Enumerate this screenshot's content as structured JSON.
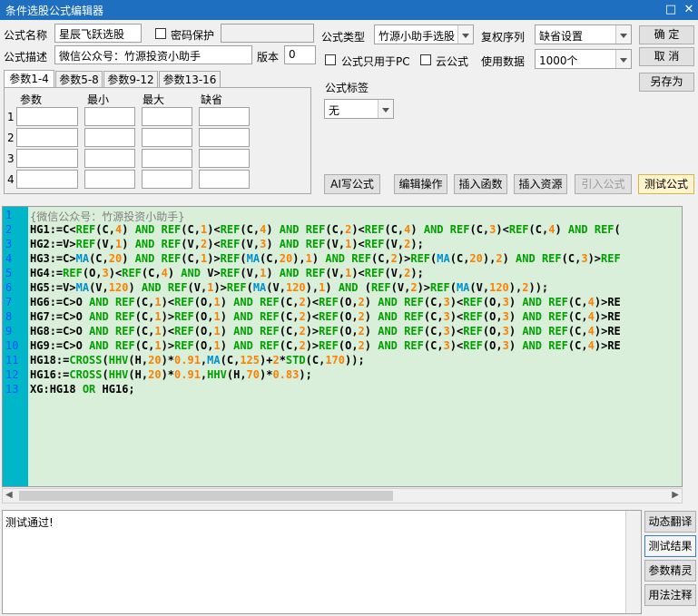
{
  "window": {
    "title": "条件选股公式编辑器",
    "close_glyph": "✕",
    "maximize_glyph": "□"
  },
  "form": {
    "name_label": "公式名称",
    "name_value": "星辰飞跃选股",
    "password_label": "密码保护",
    "desc_label": "公式描述",
    "desc_value": "微信公众号：竹源投资小助手",
    "version_label": "版本",
    "version_value": "0",
    "type_label": "公式类型",
    "type_value": "竹源小助手选股",
    "fuquan_label": "复权序列",
    "fuquan_value": "缺省设置",
    "pc_only_label": "公式只用于PC",
    "cloud_label": "云公式",
    "usedata_label": "使用数据",
    "usedata_value": "1000个",
    "tag_label": "公式标签",
    "tag_value": "无"
  },
  "buttons": {
    "ok": "确 定",
    "cancel": "取 消",
    "saveas": "另存为",
    "ai": "AI写公式",
    "edit_ops": "编辑操作",
    "insert_func": "插入函数",
    "insert_res": "插入资源",
    "import": "引入公式",
    "test": "测试公式"
  },
  "param_tabs": [
    "参数1-4",
    "参数5-8",
    "参数9-12",
    "参数13-16"
  ],
  "param_headers": [
    "参数",
    "最小",
    "最大",
    "缺省"
  ],
  "param_rows": [
    "1",
    "2",
    "3",
    "4"
  ],
  "code_lines": [
    "{微信公众号：竹源投资小助手}",
    "HG1:=C<REF(C,4) AND REF(C,1)<REF(C,4) AND REF(C,2)<REF(C,4) AND REF(C,3)<REF(C,4) AND REF(",
    "HG2:=V>REF(V,1) AND REF(V,2)<REF(V,3) AND REF(V,1)<REF(V,2);",
    "HG3:=C>MA(C,20) AND REF(C,1)>REF(MA(C,20),1) AND REF(C,2)>REF(MA(C,20),2) AND REF(C,3)>REF",
    "HG4:=REF(O,3)<REF(C,4) AND V>REF(V,1) AND REF(V,1)<REF(V,2);",
    "HG5:=V>MA(V,120) AND REF(V,1)>REF(MA(V,120),1) AND (REF(V,2)>REF(MA(V,120),2));",
    "HG6:=C>O AND REF(C,1)<REF(O,1) AND REF(C,2)<REF(O,2) AND REF(C,3)<REF(O,3) AND REF(C,4)>RE",
    "HG7:=C>O AND REF(C,1)>REF(O,1) AND REF(C,2)<REF(O,2) AND REF(C,3)<REF(O,3) AND REF(C,4)>RE",
    "HG8:=C>O AND REF(C,1)<REF(O,1) AND REF(C,2)>REF(O,2) AND REF(C,3)<REF(O,3) AND REF(C,4)>RE",
    "HG9:=C>O AND REF(C,1)>REF(O,1) AND REF(C,2)>REF(O,2) AND REF(C,3)<REF(O,3) AND REF(C,4)>RE",
    "HG18:=CROSS(HHV(H,20)*0.91,MA(C,125)+2*STD(C,170));",
    "HG16:=CROSS(HHV(H,20)*0.91,HHV(H,70)*0.83);",
    "XG:HG18 OR HG16;"
  ],
  "output_text": "测试通过!",
  "side_buttons": [
    "动态翻译",
    "测试结果",
    "参数精灵",
    "用法注释"
  ],
  "colors": {
    "titlebar": "#1e6fc0",
    "gutter": "#00b7c9",
    "editor_bg": "#d9efd9",
    "line_number": "#0050ff",
    "comment": "#808080",
    "function": "#00a000",
    "number": "#ff8000",
    "builtin": "#0090d0"
  }
}
